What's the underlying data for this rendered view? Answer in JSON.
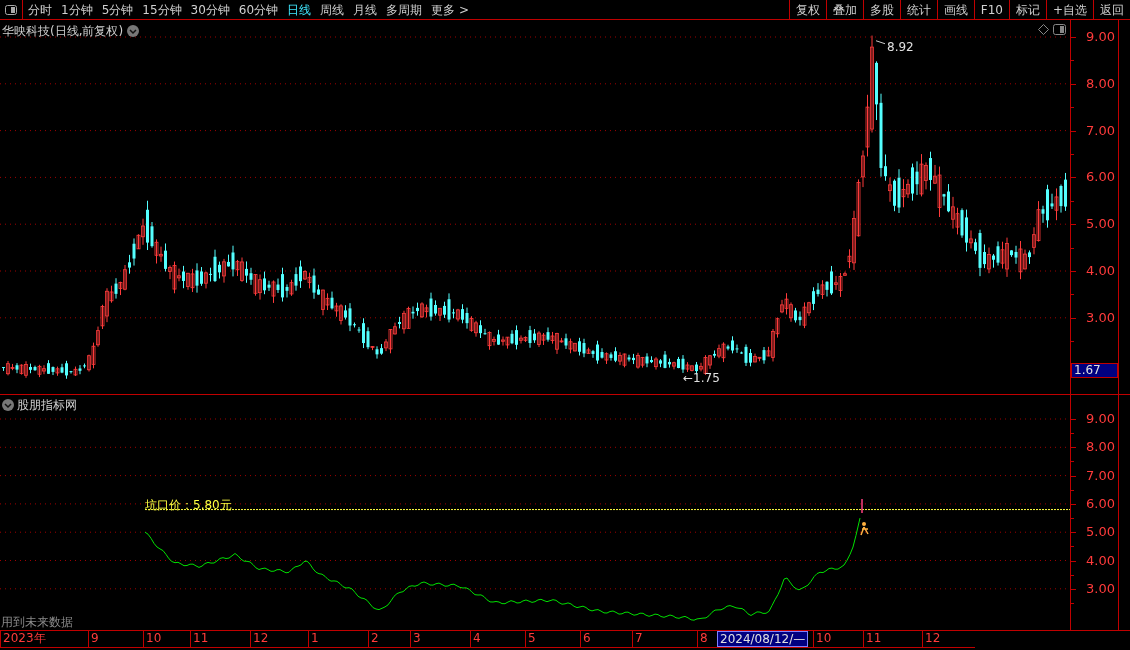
{
  "toolbar": {
    "tabs": [
      {
        "label": "分时",
        "selected": false
      },
      {
        "label": "1分钟",
        "selected": false
      },
      {
        "label": "5分钟",
        "selected": false
      },
      {
        "label": "15分钟",
        "selected": false
      },
      {
        "label": "30分钟",
        "selected": false
      },
      {
        "label": "60分钟",
        "selected": false
      },
      {
        "label": "日线",
        "selected": true
      },
      {
        "label": "周线",
        "selected": false
      },
      {
        "label": "月线",
        "selected": false
      },
      {
        "label": "多周期",
        "selected": false
      },
      {
        "label": "更多 >",
        "selected": false
      }
    ],
    "buttons": [
      "复权",
      "叠加",
      "多股",
      "统计",
      "画线",
      "F10",
      "标记",
      "+自选",
      "返回"
    ]
  },
  "main_chart": {
    "title": "华映科技(日线,前复权)",
    "y_labels": [
      "9.00",
      "8.00",
      "7.00",
      "6.00",
      "5.00",
      "4.00",
      "3.00"
    ],
    "high_label": "8.92",
    "low_label": "←1.75",
    "last_price": "1.67"
  },
  "indicator": {
    "title": "股朋指标网",
    "price_line_label": "坑口价：5.80元",
    "y_labels": [
      "9.00",
      "8.00",
      "7.00",
      "6.00",
      "5.00",
      "4.00",
      "3.00"
    ],
    "note": "用到未来数据"
  },
  "time_axis": {
    "labels": [
      {
        "text": "2023年",
        "selected": false
      },
      {
        "text": "9",
        "selected": false
      },
      {
        "text": "10",
        "selected": false
      },
      {
        "text": "11",
        "selected": false
      },
      {
        "text": "12",
        "selected": false
      },
      {
        "text": "1",
        "selected": false
      },
      {
        "text": "2",
        "selected": false
      },
      {
        "text": "3",
        "selected": false
      },
      {
        "text": "4",
        "selected": false
      },
      {
        "text": "5",
        "selected": false
      },
      {
        "text": "6",
        "selected": false
      },
      {
        "text": "7",
        "selected": false
      },
      {
        "text": "8",
        "selected": false
      },
      {
        "text": "2024/08/12/—",
        "selected": true
      },
      {
        "text": "10",
        "selected": false
      },
      {
        "text": "11",
        "selected": false
      },
      {
        "text": "12",
        "selected": false
      }
    ]
  }
}
